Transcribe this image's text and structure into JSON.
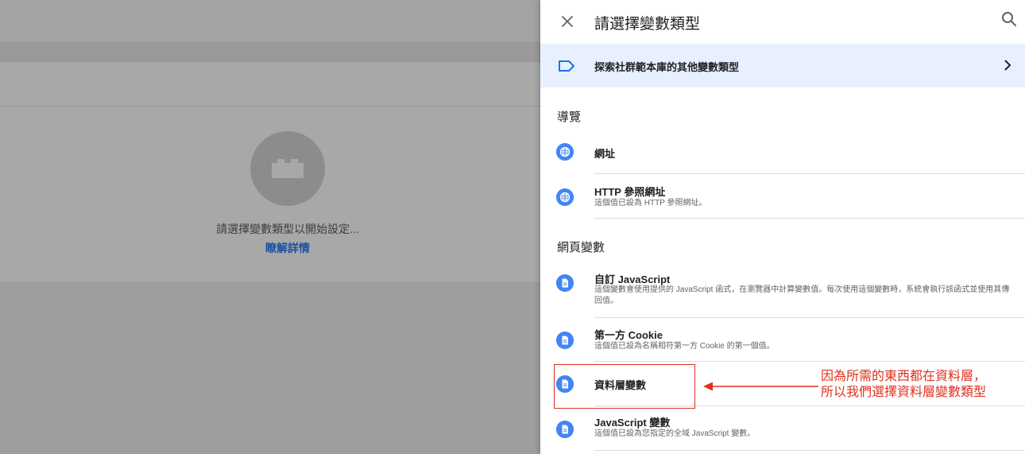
{
  "background": {
    "message": "請選擇變數類型以開始設定...",
    "learn_more": "瞭解詳情"
  },
  "panel": {
    "title": "請選擇變數類型",
    "gallery_label": "探索社群範本庫的其他變數類型",
    "sections": [
      {
        "title": "導覽",
        "items": [
          {
            "title": "網址",
            "description": ""
          },
          {
            "title": "HTTP 參照網址",
            "description": "這個值已設為 HTTP 參照網址。"
          }
        ]
      },
      {
        "title": "網頁變數",
        "items": [
          {
            "title": "自訂 JavaScript",
            "description": "這個變數會使用提供的 JavaScript 函式，在瀏覽器中計算變數值。每次使用這個變數時，系統會執行該函式並使用其傳回值。"
          },
          {
            "title": "第一方 Cookie",
            "description": "這個值已設為名稱相符第一方 Cookie 的第一個值。"
          },
          {
            "title": "資料層變數",
            "description": ""
          },
          {
            "title": "JavaScript 變數",
            "description": "這個值已設為您指定的全域 JavaScript 變數。"
          }
        ]
      }
    ]
  },
  "annotation": {
    "line1": "因為所需的東西都在資料層，",
    "line2": "所以我們選擇資料層變數類型",
    "color": "#e0301e"
  },
  "colors": {
    "accent": "#4285f4",
    "gallery_bg": "#e8f0fe"
  }
}
